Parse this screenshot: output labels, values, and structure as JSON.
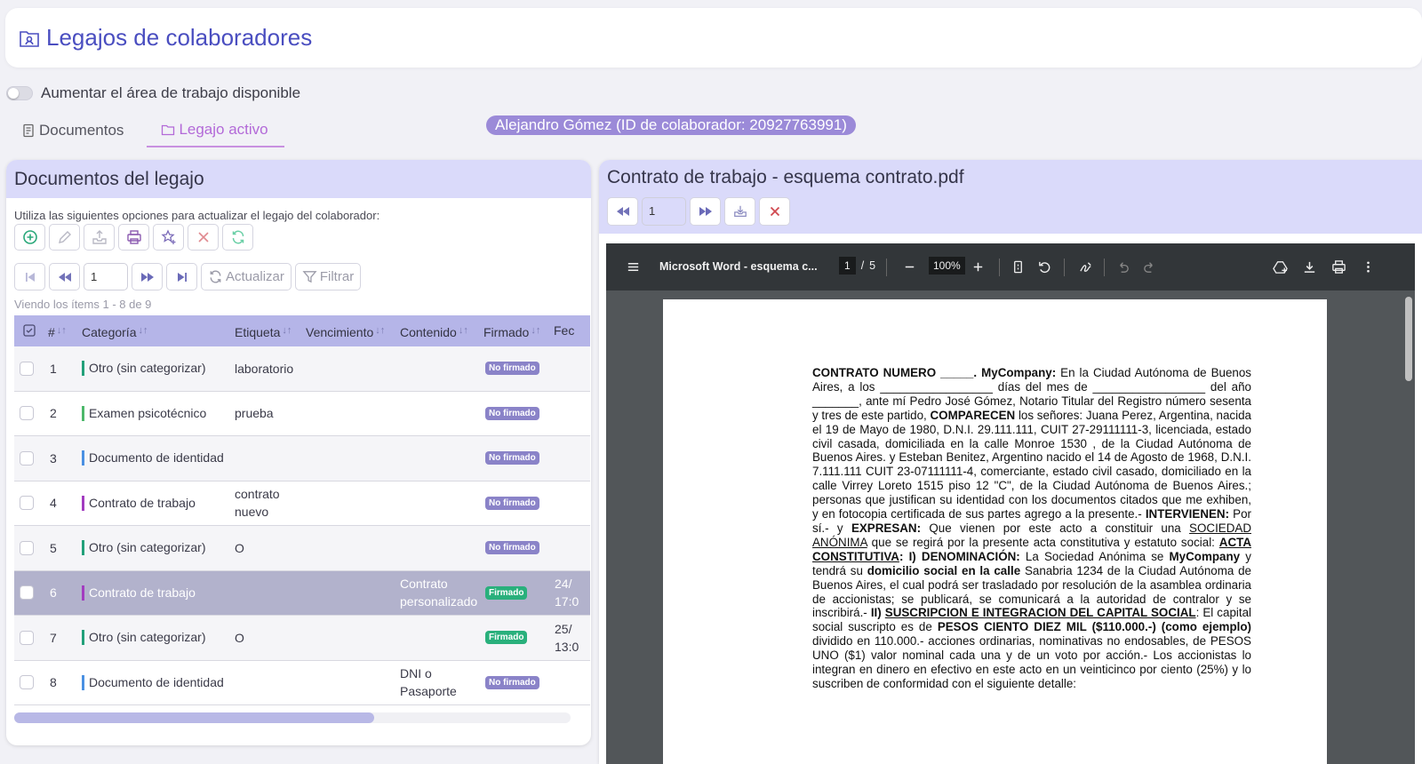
{
  "header": {
    "title": "Legajos de colaboradores",
    "brand_color": "#4a4ec0"
  },
  "workspace_toggle": {
    "label": "Aumentar el área de trabajo disponible",
    "on": false
  },
  "tabs": [
    {
      "label": "Documentos",
      "active": false
    },
    {
      "label": "Legajo activo",
      "active": true
    }
  ],
  "collaborator": {
    "badge": "Alejandro Gómez (ID de colaborador: 20927763991)"
  },
  "left_panel": {
    "title": "Documentos del legajo",
    "options_label": "Utiliza las siguientes opciones para actualizar el legajo del colaborador:",
    "tools": [
      "add-circle-icon",
      "edit-icon",
      "upload-tray-icon",
      "print-icon",
      "star-plus-icon",
      "delete-x-icon",
      "refresh-icon"
    ],
    "pager": {
      "page": "1",
      "refresh_label": "Actualizar",
      "filter_label": "Filtrar"
    },
    "viewing": "Viendo los ítems 1 - 8  de  9",
    "columns": [
      "#",
      "Categoría",
      "Etiqueta",
      "Vencimiento",
      "Contenido",
      "Firmado",
      "Fec"
    ],
    "rows": [
      {
        "n": "1",
        "category": "Otro (sin categorizar)",
        "cat_color": "#22a07a",
        "label": "laboratorio",
        "due": "",
        "content": "",
        "signed": "No firmado",
        "date": "",
        "date2": ""
      },
      {
        "n": "2",
        "category": "Examen psicotécnico",
        "cat_color": "#4cb86a",
        "label": "prueba",
        "due": "",
        "content": "",
        "signed": "No firmado",
        "date": "",
        "date2": ""
      },
      {
        "n": "3",
        "category": "Documento de identidad",
        "cat_color": "#4a90e2",
        "label": "",
        "due": "",
        "content": "",
        "signed": "No firmado",
        "date": "",
        "date2": ""
      },
      {
        "n": "4",
        "category": "Contrato de trabajo",
        "cat_color": "#a23cc0",
        "label": "contrato nuevo",
        "due": "",
        "content": "",
        "signed": "No firmado",
        "date": "",
        "date2": ""
      },
      {
        "n": "5",
        "category": "Otro (sin categorizar)",
        "cat_color": "#22a07a",
        "label": "O",
        "due": "",
        "content": "",
        "signed": "No firmado",
        "date": "",
        "date2": ""
      },
      {
        "n": "6",
        "category": "Contrato de trabajo",
        "cat_color": "#a23cc0",
        "label": "",
        "due": "",
        "content": "Contrato personalizado",
        "signed": "Firmado",
        "date": "24/",
        "date2": "17:0"
      },
      {
        "n": "7",
        "category": "Otro (sin categorizar)",
        "cat_color": "#22a07a",
        "label": "O",
        "due": "",
        "content": "",
        "signed": "Firmado",
        "date": "25/",
        "date2": "13:0"
      },
      {
        "n": "8",
        "category": "Documento de identidad",
        "cat_color": "#4a90e2",
        "label": "",
        "due": "",
        "content": "DNI o Pasaporte",
        "signed": "No firmado",
        "date": "",
        "date2": ""
      }
    ]
  },
  "right_panel": {
    "title": "Contrato de trabajo - esquema contrato.pdf",
    "page_input": "1"
  },
  "pdf_viewer": {
    "file_name": "Microsoft Word - esquema c...",
    "page_current": "1",
    "page_sep": "/",
    "page_total": "5",
    "zoom": "100%"
  },
  "document": {
    "paragraph": "<b>CONTRATO NUMERO _____. MyCompany:</b> En la Ciudad Autónoma de Buenos Aires, a los _________________ días del mes de _________________ del año _______, ante mí Pedro José Gómez, Notario Titular del Registro número sesenta y tres de este partido, <b>COMPARECEN</b> los señores: Juana Perez, Argentina, nacida el 19 de Mayo de 1980, D.N.I. 29.111.111, CUIT 27-29111111-3, licenciada, estado civil casada, domiciliada en la calle Monroe 1530 , de la Ciudad Autónoma de Buenos Aires. y Esteban Benitez, Argentino nacido el 14 de Agosto de 1968, D.N.I. 7.111.111 CUIT 23-07111111-4, comerciante, estado civil casado, domiciliado en la calle Virrey Loreto 1515 piso 12 \"C\", de la Ciudad Autónoma de Buenos Aires.; personas que justifican su identidad con los documentos citados que me exhiben, y en fotocopia certificada de sus partes agrego a la presente.- <b>INTERVIENEN:</b> Por sí.- y <b>EXPRESAN:</b> Que vienen por este acto a constituir una <u>SOCIEDAD ANÓNIMA</u> que se regirá por la presente acta constitutiva y estatuto social: <b><u>ACTA CONSTITUTIVA</u>: I) DENOMINACIÓN:</b> La Sociedad Anónima se <b>MyCompany</b> y tendrá su <b>domicilio social en la calle</b> Sanabria 1234 de la Ciudad Autónoma de Buenos Aires, el cual podrá ser trasladado por resolución de la asamblea ordinaria de accionistas; se publicará, se comunicará a la autoridad de contralor y se inscribirá.- <b>II) <u>SUSCRIPCION E INTEGRACION DEL CAPITAL SOCIAL</u></b>: El capital social suscripto es de <b>PESOS CIENTO DIEZ MIL ($110.000.-) (como ejemplo)</b> dividido en 110.000.- acciones ordinarias, nominativas no endosables, de PESOS UNO ($1) valor nominal cada una y de un voto por acción.- Los accionistas lo integran en dinero en efectivo en este acto en un veinticinco por ciento (25%) y lo suscriben de conformidad con el siguiente detalle:"
  }
}
